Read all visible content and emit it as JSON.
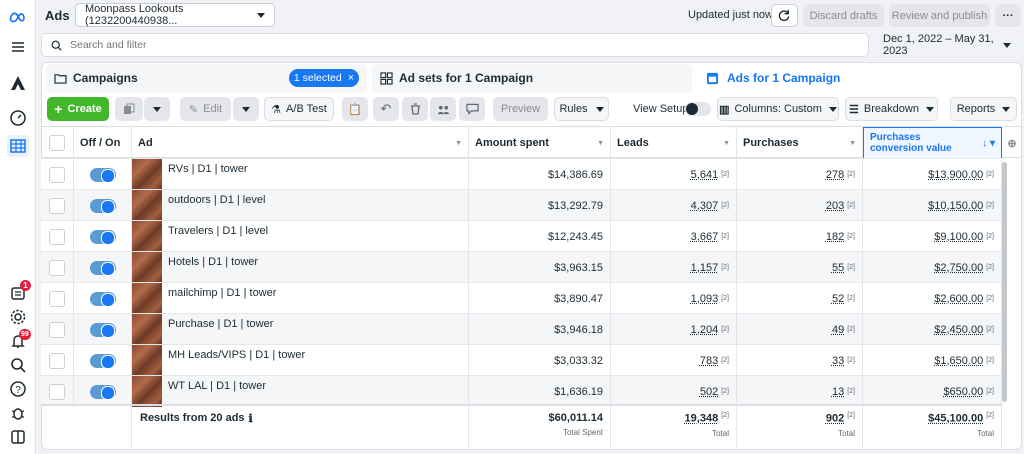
{
  "topbar": {
    "title": "Ads",
    "account": "Moonpass Lookouts (1232200440938...",
    "updated": "Updated just now",
    "discard": "Discard drafts",
    "review": "Review and publish",
    "more": "···"
  },
  "search": {
    "placeholder": "Search and filter"
  },
  "date_range": "Dec 1, 2022 – May 31, 2023",
  "tabs": {
    "campaigns": "Campaigns",
    "selected": "1 selected",
    "adsets": "Ad sets for 1 Campaign",
    "ads": "Ads for 1 Campaign"
  },
  "toolbar": {
    "create": "Create",
    "edit": "Edit",
    "abtest": "A/B Test",
    "preview": "Preview",
    "rules": "Rules",
    "view_setup": "View Setup",
    "columns": "Columns: Custom",
    "breakdown": "Breakdown",
    "reports": "Reports"
  },
  "table": {
    "headers": {
      "off_on": "Off / On",
      "ad": "Ad",
      "amount": "Amount spent",
      "leads": "Leads",
      "purchases": "Purchases",
      "conv_value": "Purchases conversion value"
    },
    "rows": [
      {
        "ad": "RVs | D1 | tower",
        "amount": "$14,386.69",
        "leads": "5,641",
        "purchases": "278",
        "value": "$13,900.00"
      },
      {
        "ad": "outdoors | D1 | level",
        "amount": "$13,292.79",
        "leads": "4,307",
        "purchases": "203",
        "value": "$10,150.00"
      },
      {
        "ad": "Travelers | D1 | level",
        "amount": "$12,243.45",
        "leads": "3,667",
        "purchases": "182",
        "value": "$9,100.00"
      },
      {
        "ad": "Hotels | D1 | tower",
        "amount": "$3,963.15",
        "leads": "1,157",
        "purchases": "55",
        "value": "$2,750.00"
      },
      {
        "ad": "mailchimp | D1 | tower",
        "amount": "$3,890.47",
        "leads": "1,093",
        "purchases": "52",
        "value": "$2,600.00"
      },
      {
        "ad": "Purchase | D1 | tower",
        "amount": "$3,946.18",
        "leads": "1,204",
        "purchases": "49",
        "value": "$2,450.00"
      },
      {
        "ad": "MH Leads/VIPS | D1 | tower",
        "amount": "$3,033.32",
        "leads": "783",
        "purchases": "33",
        "value": "$1,650.00"
      },
      {
        "ad": "WT LAL | D1 | tower",
        "amount": "$1,636.19",
        "leads": "502",
        "purchases": "13",
        "value": "$650.00"
      }
    ],
    "footnote": "[2]",
    "totals": {
      "label": "Results from 20 ads",
      "amount": "$60,011.14",
      "amount_sub": "Total Spent",
      "leads": "19,348",
      "leads_sub": "Total",
      "purchases": "902",
      "purchases_sub": "Total",
      "value": "$45,100.00",
      "value_sub": "Total"
    }
  },
  "rail_badges": {
    "notif1": "1",
    "notif2": "99"
  },
  "colors": {
    "accent": "#1877f2",
    "create": "#42b72a",
    "badge": "#e41e3f"
  }
}
